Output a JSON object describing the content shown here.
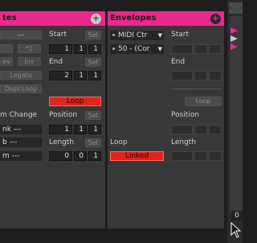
{
  "left_panel": {
    "title": "tes",
    "buttons": [
      "---",
      "*2",
      "ev",
      "Inv",
      "Legato",
      "Dupl.Loop"
    ],
    "start_label": "Start",
    "start_set": "Set",
    "start_values": [
      "1",
      "1",
      "1"
    ],
    "end_label": "End",
    "end_set": "Set",
    "end_values": [
      "2",
      "1",
      "1"
    ],
    "loop_label": "Loop",
    "program_change_label": "m Change",
    "program_fields": [
      "nk ---",
      "b ---",
      "m ---"
    ],
    "position_label": "Position",
    "position_set": "Set",
    "position_values": [
      "1",
      "1",
      "1"
    ],
    "length_label": "Length",
    "length_set": "Set",
    "length_values": [
      "0",
      "0",
      "1"
    ]
  },
  "envelopes_panel": {
    "title": "Envelopes",
    "device_select": "MIDI Ctr",
    "control_select": "50 - (Cor",
    "start_label": "Start",
    "end_label": "End",
    "loop_button": "Loop",
    "position_label": "Position",
    "loop_label": "Loop",
    "linked_button": "Linked",
    "length_label": "Length"
  },
  "side_strip": {
    "value": "0"
  },
  "colors": {
    "accent": "#e8298e",
    "active_red": "#e3231f",
    "panel": "#383838",
    "background": "#1e1e1e"
  }
}
